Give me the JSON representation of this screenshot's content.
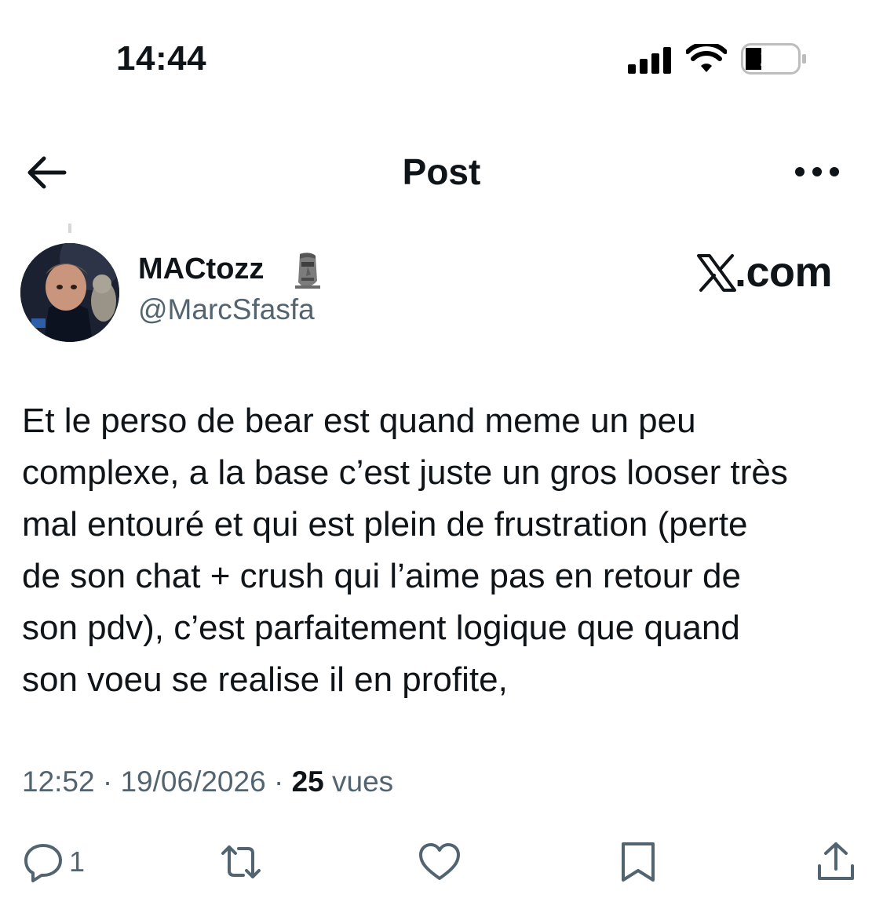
{
  "status_bar": {
    "time": "14:44",
    "battery_level": "29",
    "icons": [
      "signal-icon",
      "wifi-icon",
      "battery-icon"
    ]
  },
  "nav": {
    "title": "Post",
    "back_icon": "arrow-left-icon",
    "more_icon": "more-dots-icon"
  },
  "author": {
    "display_name": "MACtozz",
    "name_emoji_icon": "moai-icon",
    "handle": "@MarcSfasfa"
  },
  "brand": {
    "text": ".com",
    "icon": "x-logo-icon"
  },
  "post": {
    "lines": [
      "Et le perso de bear est quand meme un peu",
      "complexe, a la base c’est juste un gros looser très",
      "mal entouré et qui est plein de frustration (perte",
      "de son chat + crush qui l’aime pas en retour de",
      "son pdv), c’est parfaitement logique que quand",
      "son voeu se realise il en profite,"
    ]
  },
  "meta": {
    "time": "12:52",
    "separator": " · ",
    "date": "19/06/2026",
    "views_count": "25",
    "views_label": " vues"
  },
  "actions": {
    "reply_count": "1",
    "icons": [
      "reply-icon",
      "repost-icon",
      "like-icon",
      "bookmark-icon",
      "share-icon"
    ]
  },
  "colors": {
    "text": "#0f1419",
    "secondary": "#536471",
    "background": "#ffffff"
  }
}
